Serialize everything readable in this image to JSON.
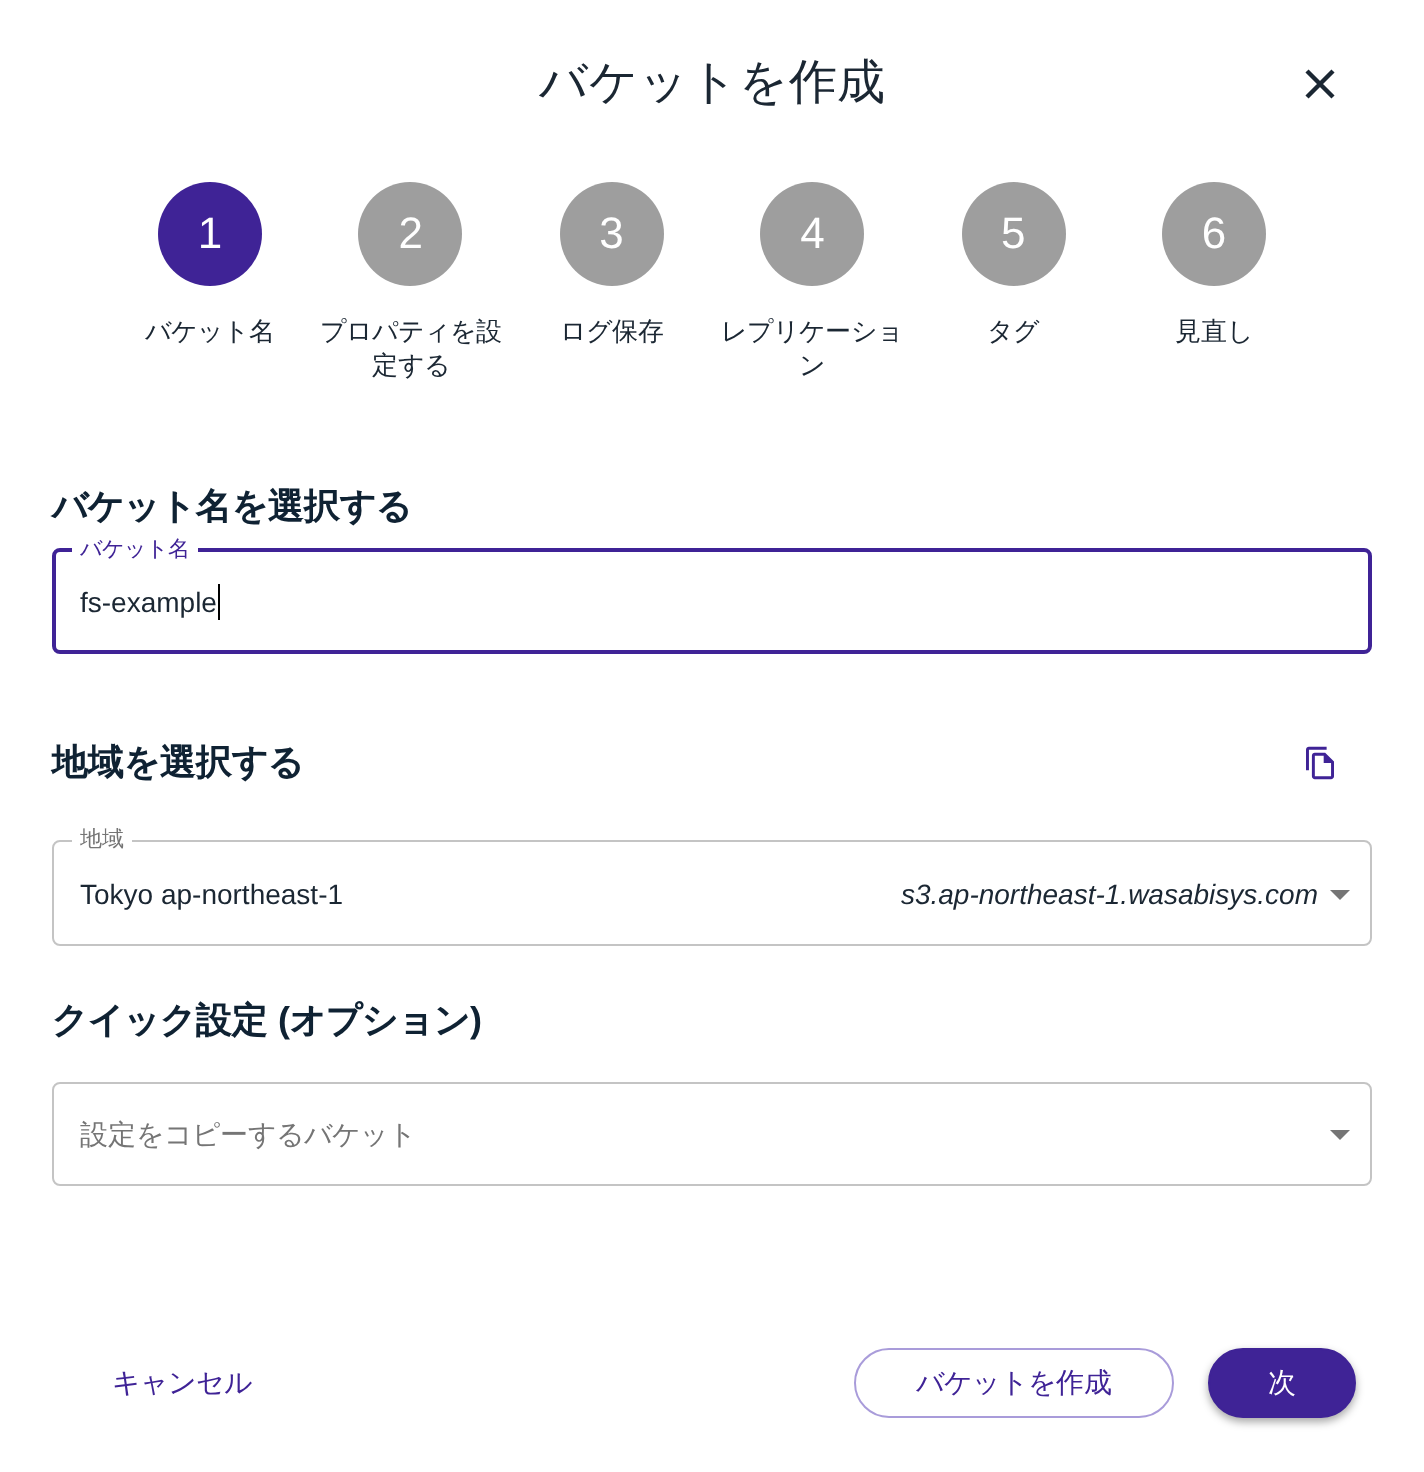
{
  "dialog": {
    "title": "バケットを作成"
  },
  "steps": [
    {
      "number": "1",
      "label": "バケット名",
      "selected": true
    },
    {
      "number": "2",
      "label": "プロパティを設定する",
      "selected": false
    },
    {
      "number": "3",
      "label": "ログ保存",
      "selected": false
    },
    {
      "number": "4",
      "label": "レプリケーション",
      "selected": false
    },
    {
      "number": "5",
      "label": "タグ",
      "selected": false
    },
    {
      "number": "6",
      "label": "見直し",
      "selected": false
    }
  ],
  "bucket_section": {
    "heading": "バケット名を選択する",
    "field": {
      "label": "バケット名",
      "value": "fs-example",
      "focused": true
    }
  },
  "region_section": {
    "heading": "地域を選択する",
    "field": {
      "label": "地域",
      "value": "Tokyo ap-northeast-1",
      "endpoint": "s3.ap-northeast-1.wasabisys.com"
    }
  },
  "quick_settings": {
    "heading": "クイック設定 (オプション)",
    "field": {
      "placeholder": "設定をコピーするバケット"
    }
  },
  "footer": {
    "cancel": "キャンセル",
    "buttons": [
      {
        "label": "バケットを作成",
        "kind": "outlined"
      },
      {
        "label": "次",
        "kind": "filled"
      }
    ]
  }
}
